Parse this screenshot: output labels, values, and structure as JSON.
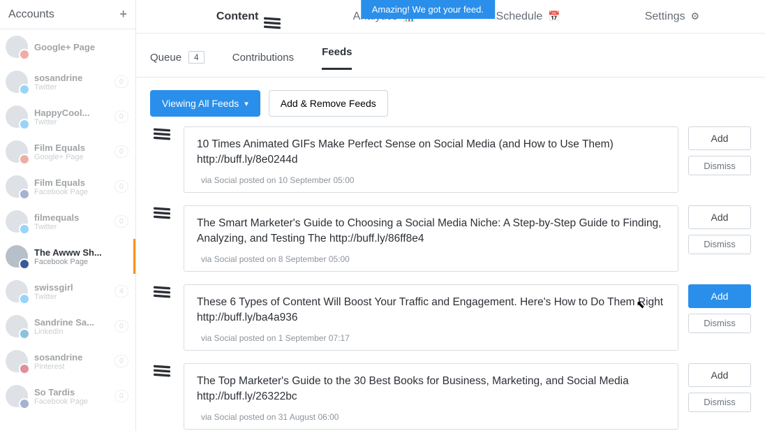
{
  "toast": "Amazing! We got your feed.",
  "sidebar": {
    "title": "Accounts",
    "accounts": [
      {
        "name": "Google+ Page",
        "sub": "",
        "count": "",
        "avatar": "gp",
        "badge": "gp"
      },
      {
        "name": "sosandrine",
        "sub": "Twitter",
        "count": "0",
        "avatar": "tw",
        "badge": "tw"
      },
      {
        "name": "HappyCool...",
        "sub": "Twitter",
        "count": "0",
        "avatar": "any",
        "badge": "tw"
      },
      {
        "name": "Film Equals",
        "sub": "Google+ Page",
        "count": "0",
        "avatar": "any",
        "badge": "gp"
      },
      {
        "name": "Film Equals",
        "sub": "Facebook Page",
        "count": "0",
        "avatar": "any",
        "badge": "fb"
      },
      {
        "name": "filmequals",
        "sub": "Twitter",
        "count": "0",
        "avatar": "any",
        "badge": "tw"
      },
      {
        "name": "The Awww Sh...",
        "sub": "Facebook Page",
        "count": "",
        "avatar": "fb",
        "badge": "fb",
        "active": true
      },
      {
        "name": "swissgirl",
        "sub": "Twitter",
        "count": "4",
        "avatar": "tw",
        "badge": "tw"
      },
      {
        "name": "Sandrine Sa...",
        "sub": "LinkedIn",
        "count": "0",
        "avatar": "li",
        "badge": "li"
      },
      {
        "name": "sosandrine",
        "sub": "Pinterest",
        "count": "0",
        "avatar": "pin",
        "badge": "pin"
      },
      {
        "name": "So Tardis",
        "sub": "Facebook Page",
        "count": "0",
        "avatar": "any",
        "badge": "fb"
      }
    ]
  },
  "nav": {
    "content": "Content",
    "analytics": "Analytics",
    "schedule": "Schedule",
    "settings": "Settings"
  },
  "subnav": {
    "queue": "Queue",
    "queue_count": "4",
    "contributions": "Contributions",
    "feeds": "Feeds"
  },
  "filters": {
    "view_all": "Viewing All Feeds",
    "add_remove": "Add & Remove Feeds"
  },
  "actions": {
    "add": "Add",
    "dismiss": "Dismiss"
  },
  "feeds": [
    {
      "title": "10 Times Animated GIFs Make Perfect Sense on Social Media (and How to Use Them) http://buff.ly/8e0244d",
      "meta": "via Social posted on 10 September 05:00",
      "add_primary": false
    },
    {
      "title": "The Smart Marketer's Guide to Choosing a Social Media Niche: A Step-by-Step Guide to Finding, Analyzing, and Testing The http://buff.ly/86ff8e4",
      "meta": "via Social posted on 8 September 05:00",
      "add_primary": false
    },
    {
      "title": "These 6 Types of Content Will Boost Your Traffic and Engagement. Here's How to Do Them Right http://buff.ly/ba4a936",
      "meta": "via Social posted on 1 September 07:17",
      "add_primary": true
    },
    {
      "title": "The Top Marketer's Guide to the 30 Best Books for Business, Marketing, and Social Media http://buff.ly/26322bc",
      "meta": "via Social posted on 31 August 06:00",
      "add_primary": false
    }
  ]
}
